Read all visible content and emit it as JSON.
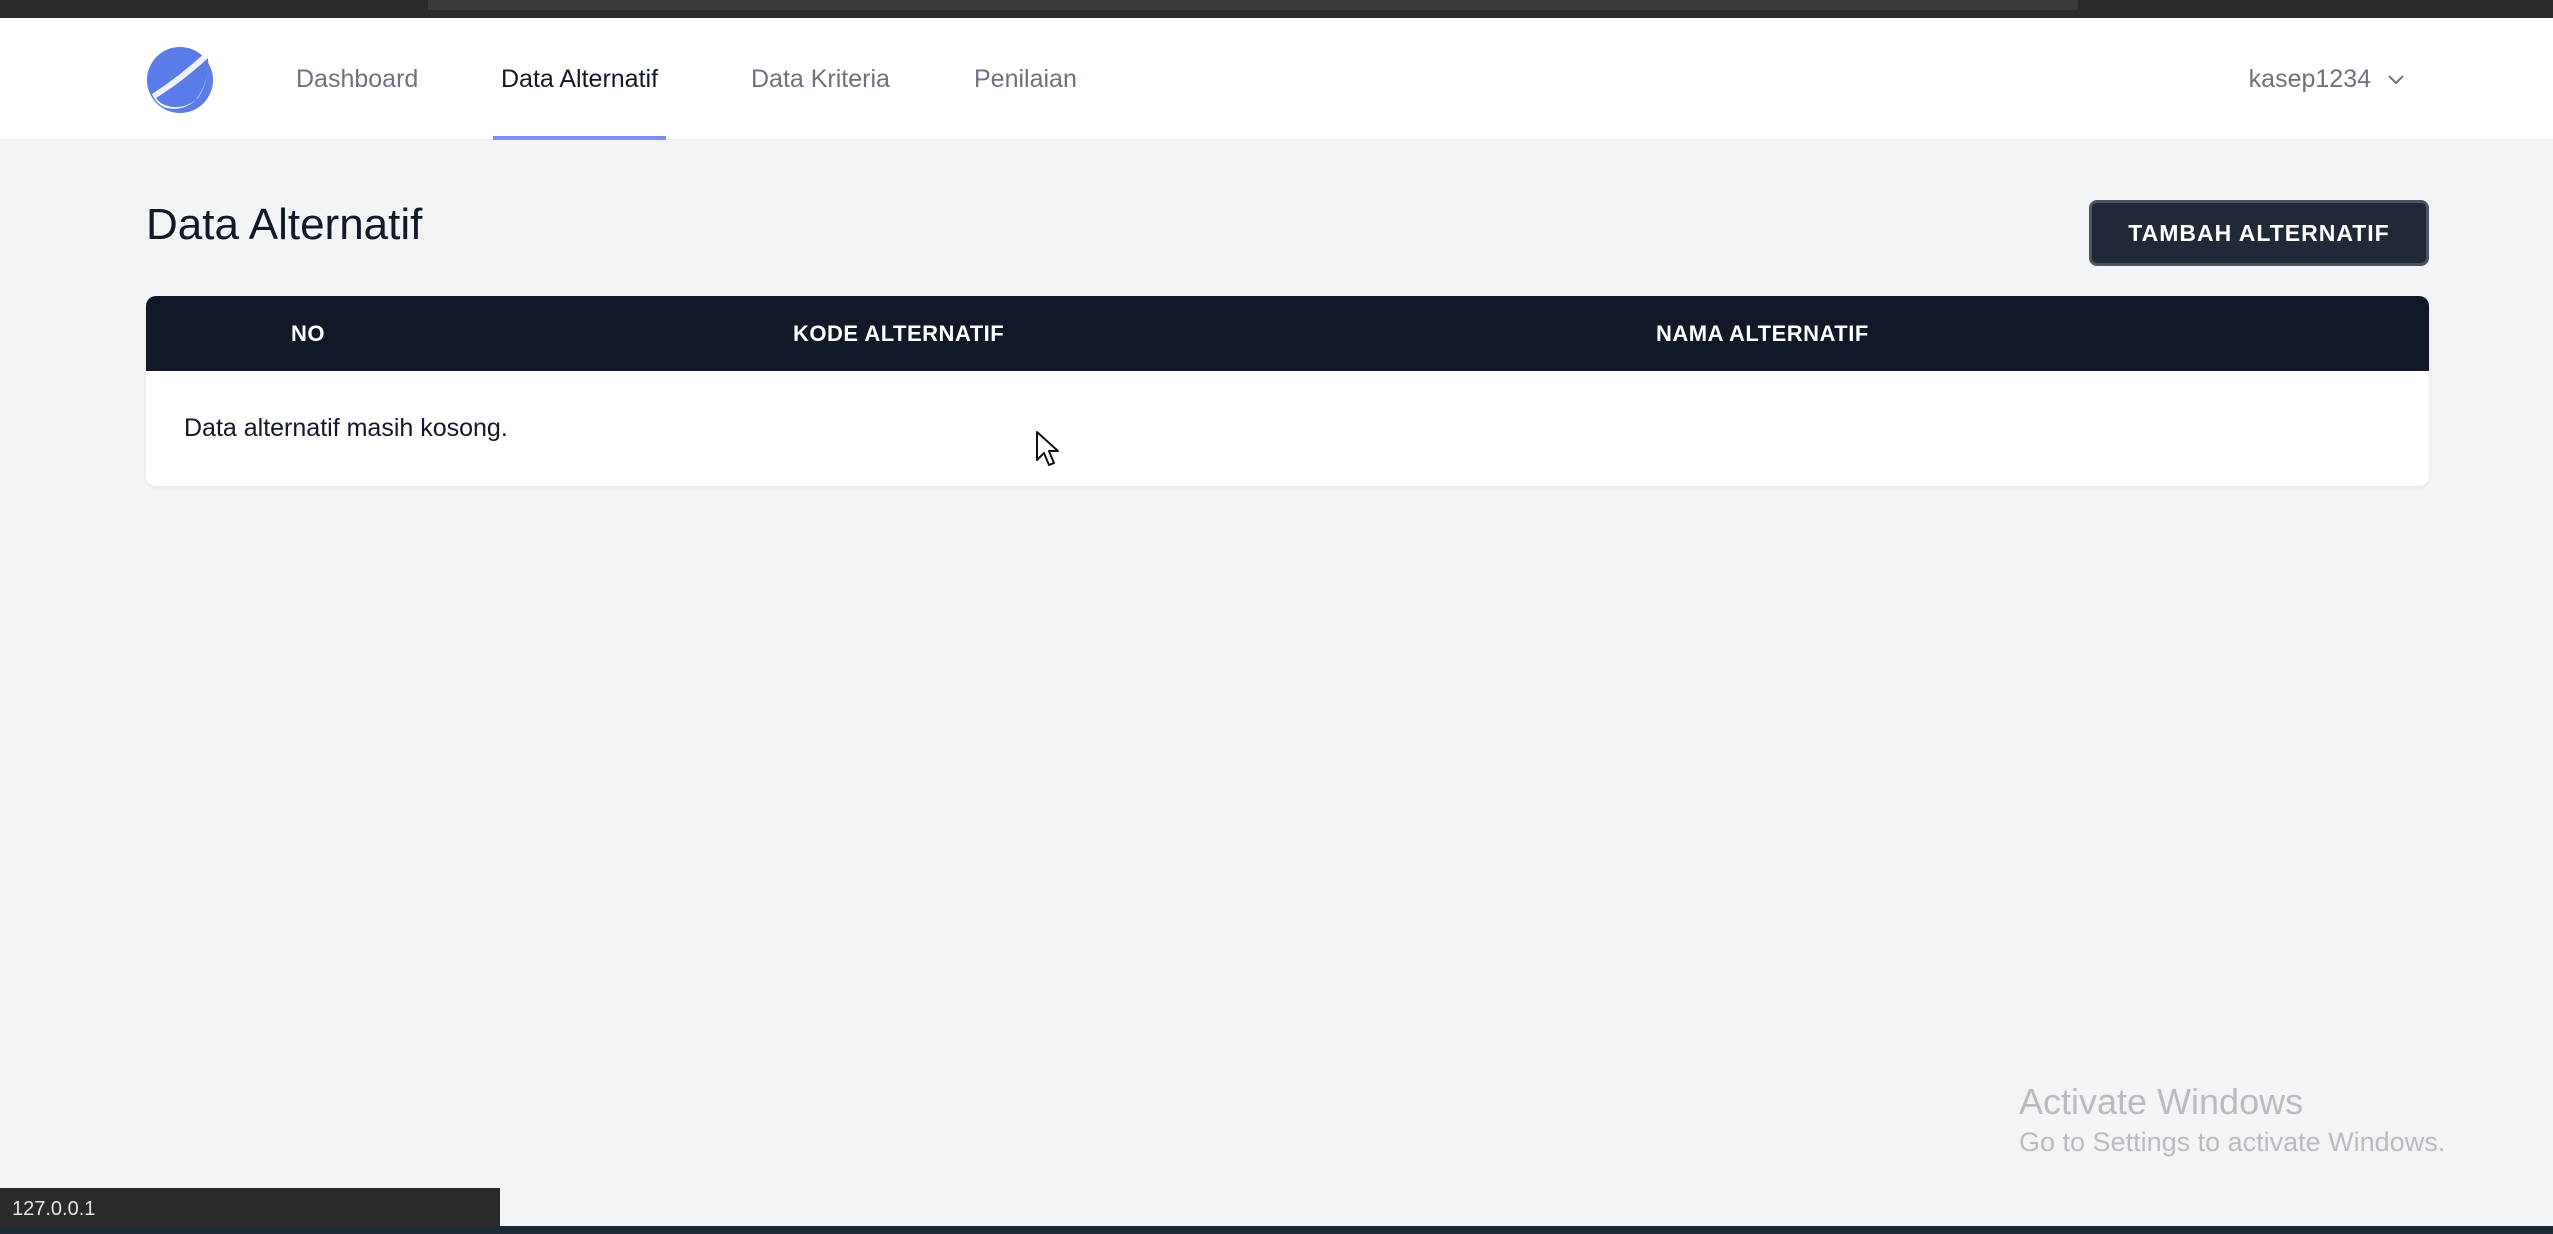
{
  "nav": {
    "items": [
      {
        "label": "Dashboard",
        "active": false
      },
      {
        "label": "Data Alternatif",
        "active": true
      },
      {
        "label": "Data Kriteria",
        "active": false
      },
      {
        "label": "Penilaian",
        "active": false
      }
    ],
    "user": {
      "name": "kasep1234",
      "icon": "chevron-down-icon"
    },
    "logo_icon": "app-logo-icon"
  },
  "page": {
    "title": "Data Alternatif",
    "add_button_label": "TAMBAH ALTERNATIF"
  },
  "table": {
    "columns": [
      "NO",
      "KODE ALTERNATIF",
      "NAMA ALTERNATIF"
    ],
    "empty_message": "Data alternatif masih kosong."
  },
  "watermark": {
    "title": "Activate Windows",
    "subtitle": "Go to Settings to activate Windows."
  },
  "status_bar": {
    "url": "127.0.0.1"
  },
  "colors": {
    "accent": "#818cf8",
    "header_dark": "#111827",
    "button_dark": "#1f2937",
    "logo_blue": "#5b7be8",
    "background": "#f3f4f6"
  }
}
